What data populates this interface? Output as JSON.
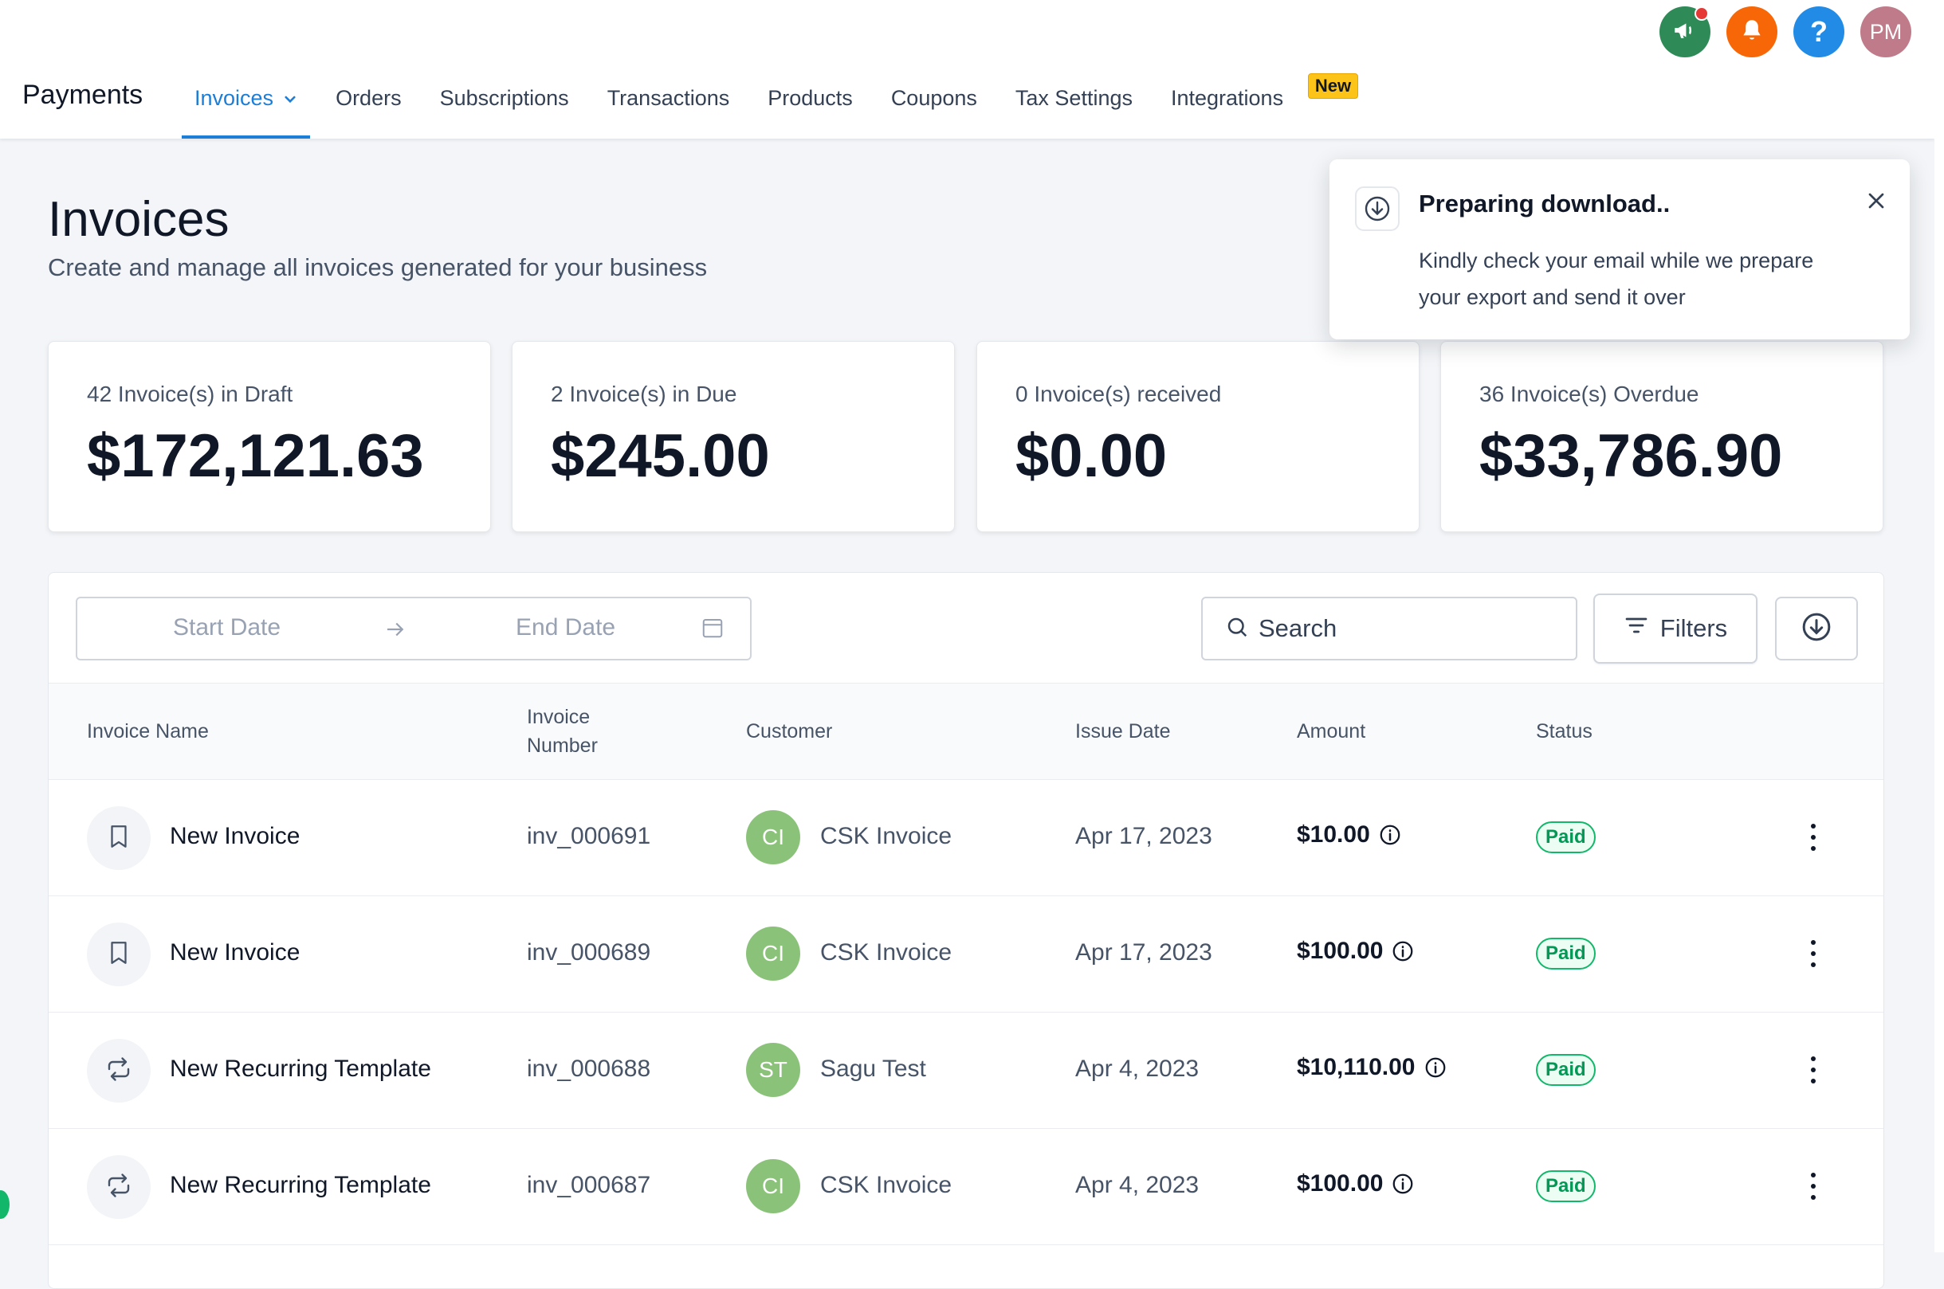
{
  "header": {
    "brand": "Payments",
    "nav": [
      {
        "label": "Invoices",
        "active": true
      },
      {
        "label": "Orders"
      },
      {
        "label": "Subscriptions"
      },
      {
        "label": "Transactions"
      },
      {
        "label": "Products"
      },
      {
        "label": "Coupons"
      },
      {
        "label": "Tax Settings"
      },
      {
        "label": "Integrations",
        "badge": "New"
      }
    ],
    "icons": [
      {
        "name": "megaphone-icon",
        "color": "#2e8b57"
      },
      {
        "name": "bell-icon",
        "color": "#f76707"
      },
      {
        "name": "help-icon",
        "color": "#228be6",
        "glyph": "?"
      },
      {
        "name": "user-avatar",
        "color": "#c07b8a",
        "initials": "PM"
      }
    ]
  },
  "page": {
    "title": "Invoices",
    "subtitle": "Create and manage all invoices generated for your business"
  },
  "stats": [
    {
      "label": "42 Invoice(s) in Draft",
      "value": "$172,121.63"
    },
    {
      "label": "2 Invoice(s) in Due",
      "value": "$245.00"
    },
    {
      "label": "0 Invoice(s) received",
      "value": "$0.00"
    },
    {
      "label": "36 Invoice(s) Overdue",
      "value": "$33,786.90"
    }
  ],
  "toolbar": {
    "start_placeholder": "Start Date",
    "end_placeholder": "End Date",
    "search_placeholder": "Search",
    "filters_label": "Filters"
  },
  "table": {
    "columns": [
      "Invoice Name",
      "Invoice Number",
      "Customer",
      "Issue Date",
      "Amount",
      "Status"
    ],
    "rows": [
      {
        "type": "invoice",
        "name": "New Invoice",
        "number": "inv_000691",
        "initials": "CI",
        "customer": "CSK Invoice",
        "date": "Apr 17, 2023",
        "amount": "$10.00",
        "status": "Paid"
      },
      {
        "type": "invoice",
        "name": "New Invoice",
        "number": "inv_000689",
        "initials": "CI",
        "customer": "CSK Invoice",
        "date": "Apr 17, 2023",
        "amount": "$100.00",
        "status": "Paid"
      },
      {
        "type": "recurring",
        "name": "New Recurring Template",
        "number": "inv_000688",
        "initials": "ST",
        "customer": "Sagu Test",
        "date": "Apr 4, 2023",
        "amount": "$10,110.00",
        "status": "Paid"
      },
      {
        "type": "recurring",
        "name": "New Recurring Template",
        "number": "inv_000687",
        "initials": "CI",
        "customer": "CSK Invoice",
        "date": "Apr 4, 2023",
        "amount": "$100.00",
        "status": "Paid"
      }
    ]
  },
  "toast": {
    "title": "Preparing download..",
    "line1": "Kindly check your email while we prepare",
    "line2": "your export and send it over"
  }
}
